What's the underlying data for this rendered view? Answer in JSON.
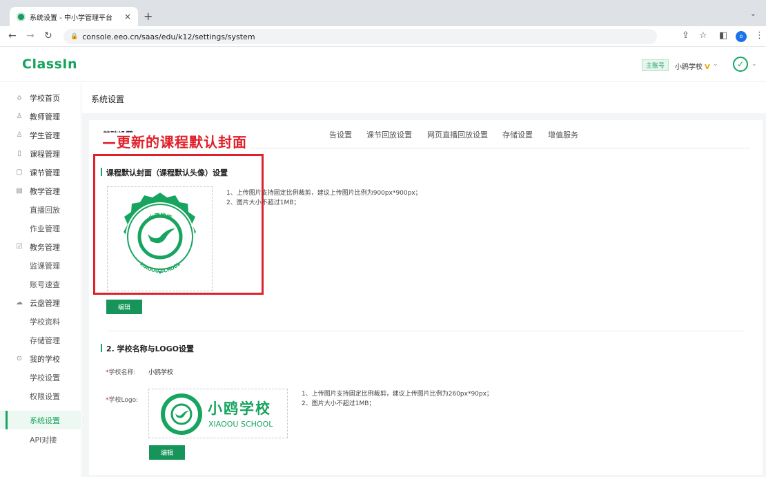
{
  "browser": {
    "tab_title": "系统设置 - 中小学管理平台",
    "tab_close": "×",
    "new_tab": "+",
    "url": "console.eeo.cn/saas/edu/k12/settings/system",
    "profile_initial": "o"
  },
  "header": {
    "logo": "ClassIn",
    "account_badge": "主账号",
    "school_name": "小鸥学校",
    "vip_mark": "V"
  },
  "sidebar": {
    "items": [
      {
        "label": "学校首页",
        "icon": "home-icon"
      },
      {
        "label": "教师管理",
        "icon": "user-icon"
      },
      {
        "label": "学生管理",
        "icon": "student-icon"
      },
      {
        "label": "课程管理",
        "icon": "course-icon"
      },
      {
        "label": "课节管理",
        "icon": "lesson-icon"
      },
      {
        "label": "教学管理",
        "icon": "teaching-icon"
      },
      {
        "label": "直播回放"
      },
      {
        "label": "作业管理"
      },
      {
        "label": "教务管理",
        "icon": "affairs-icon"
      },
      {
        "label": "监课管理"
      },
      {
        "label": "账号速查"
      },
      {
        "label": "云盘管理",
        "icon": "cloud-icon"
      },
      {
        "label": "学校资料"
      },
      {
        "label": "存储管理"
      },
      {
        "label": "我的学校",
        "icon": "school-icon"
      },
      {
        "label": "学校设置"
      },
      {
        "label": "权限设置"
      },
      {
        "label": "系统设置"
      },
      {
        "label": "API对接"
      }
    ]
  },
  "page": {
    "title": "系统设置",
    "tabs": [
      "基础设置",
      "告设置",
      "课节回放设置",
      "网页直播回放设置",
      "存储设置",
      "增值服务"
    ]
  },
  "annotation": {
    "label": "—更新的课程默认封面"
  },
  "section1": {
    "title": "课程默认封面（课程默认头像）设置",
    "notes": [
      "1、上传图片支持固定比例裁剪，建议上传图片比例为900px*900px；",
      "2、图片大小不超过1MB；"
    ],
    "badge_top_text": "小鸥学校",
    "badge_bottom_text": "XIAOOU SCHOOL",
    "edit_button": "编辑"
  },
  "section2": {
    "title": "2. 学校名称与LOGO设置",
    "name_label": "学校名称:",
    "name_value": "小鸥学校",
    "logo_label": "学校Logo:",
    "logo_cn": "小鸥学校",
    "logo_en": "XIAOOU SCHOOL",
    "notes": [
      "1、上传图片支持固定比例裁剪，建议上传图片比例为260px*90px；",
      "2、图片大小不超过1MB；"
    ],
    "edit_button": "编辑"
  },
  "colors": {
    "brand_green": "#17a45e",
    "annotation_red": "#e0202a"
  }
}
